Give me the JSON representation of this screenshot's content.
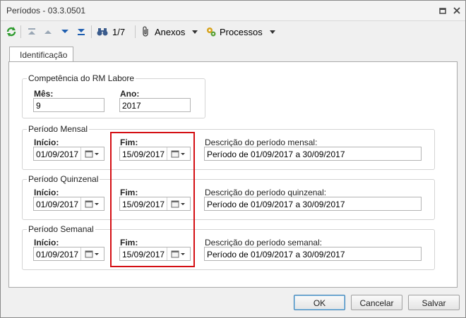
{
  "window": {
    "title": "Períodos - 03.3.0501"
  },
  "toolbar": {
    "record_counter": "1/7",
    "anexos_label": "Anexos",
    "processos_label": "Processos"
  },
  "tabs": [
    {
      "label": "Identificação"
    }
  ],
  "competencia": {
    "legend": "Competência do RM Labore",
    "mes_label": "Mês:",
    "mes_value": "9",
    "ano_label": "Ano:",
    "ano_value": "2017"
  },
  "mensal": {
    "legend": "Período Mensal",
    "inicio_label": "Início:",
    "inicio_value": "01/09/2017",
    "fim_label": "Fim:",
    "fim_value": "15/09/2017",
    "descricao_label": "Descrição do período mensal:",
    "descricao_value": "Período de 01/09/2017 a 30/09/2017"
  },
  "quinzenal": {
    "legend": "Período Quinzenal",
    "inicio_label": "Início:",
    "inicio_value": "01/09/2017",
    "fim_label": "Fim:",
    "fim_value": "15/09/2017",
    "descricao_label": "Descrição do período quinzenal:",
    "descricao_value": "Período de 01/09/2017 a 30/09/2017"
  },
  "semanal": {
    "legend": "Período Semanal",
    "inicio_label": "Início:",
    "inicio_value": "01/09/2017",
    "fim_label": "Fim:",
    "fim_value": "15/09/2017",
    "descricao_label": "Descrição do período semanal:",
    "descricao_value": "Período de 01/09/2017 a 30/09/2017"
  },
  "buttons": {
    "ok": "OK",
    "cancelar": "Cancelar",
    "salvar": "Salvar"
  },
  "colors": {
    "highlight": "#d40f14",
    "accent": "#3c7fb1"
  }
}
